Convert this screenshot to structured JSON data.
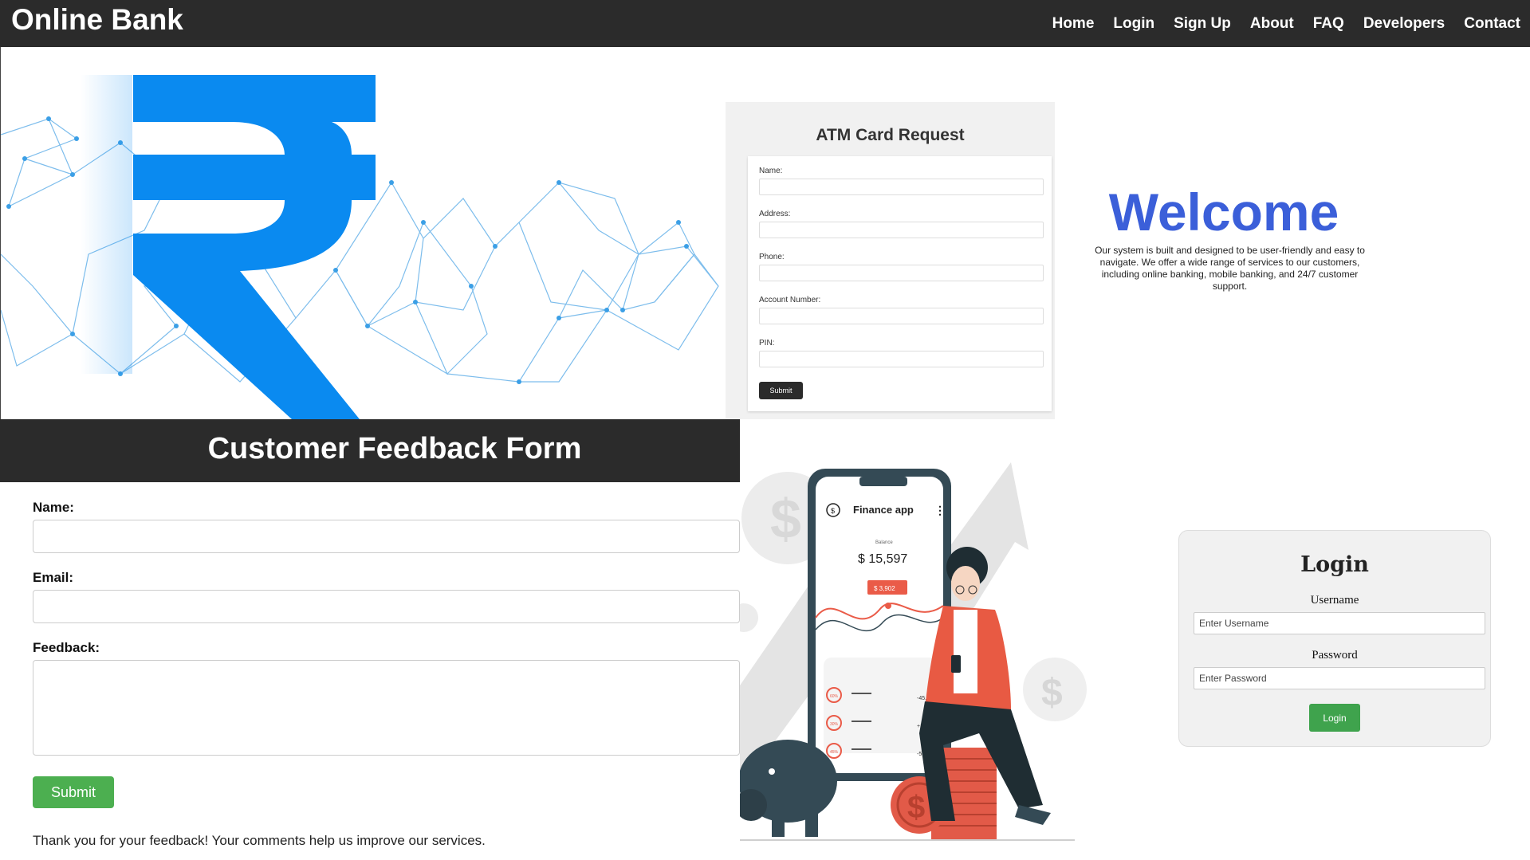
{
  "header": {
    "brand": "Online Bank",
    "nav": [
      "Home",
      "Login",
      "Sign Up",
      "About",
      "FAQ",
      "Developers",
      "Contact"
    ]
  },
  "hero": {
    "icon": "rupee-icon",
    "accent": "#0a8af0"
  },
  "atm": {
    "title": "ATM Card Request",
    "fields": [
      "Name:",
      "Address:",
      "Phone:",
      "Account Number:",
      "PIN:"
    ],
    "submit": "Submit"
  },
  "welcome": {
    "title": "Welcome",
    "text": "Our system is built and designed to be user-friendly and easy to navigate. We offer a wide range of services to our customers, including online banking, mobile banking, and 24/7 customer support.",
    "color": "#3b5fd9"
  },
  "feedback": {
    "title": "Customer Feedback Form",
    "name_label": "Name:",
    "email_label": "Email:",
    "feedback_label": "Feedback:",
    "submit": "Submit",
    "thanks": "Thank you for your feedback! Your comments help us improve our services."
  },
  "finance_app": {
    "app_title": "Finance app",
    "balance_label": "Balance",
    "balance": "$ 15,597",
    "badge": "$ 3,902",
    "rows": [
      "-45,90",
      "+100",
      "-56,9"
    ],
    "pct": [
      "60%",
      "30%",
      "45%"
    ]
  },
  "login": {
    "title": "Login",
    "username_label": "Username",
    "username_placeholder": "Enter Username",
    "password_label": "Password",
    "password_placeholder": "Enter Password",
    "button": "Login",
    "button_color": "#3fa34d"
  }
}
